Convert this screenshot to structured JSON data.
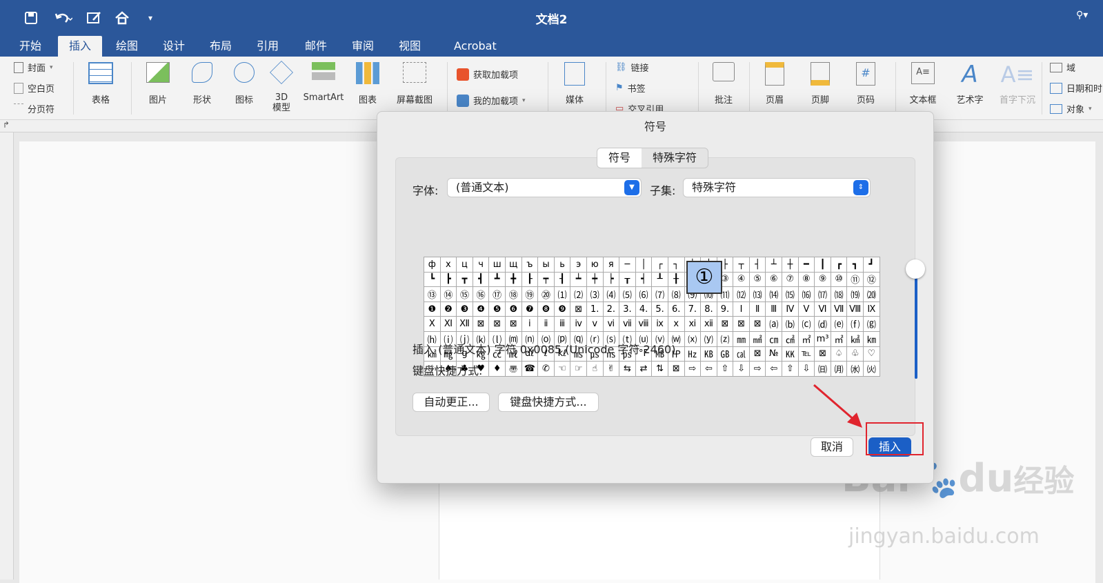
{
  "window": {
    "title": "文档2"
  },
  "ribbon_tabs": [
    "开始",
    "插入",
    "绘图",
    "设计",
    "布局",
    "引用",
    "邮件",
    "审阅",
    "视图",
    "Acrobat"
  ],
  "ribbon": {
    "pages": [
      "封面",
      "空白页",
      "分页符"
    ],
    "table": "表格",
    "picture": "图片",
    "shapes": "形状",
    "icons": "图标",
    "model3d": "3D\n模型",
    "smartart": "SmartArt",
    "chart": "图表",
    "screenshot": "屏幕截图",
    "addins": [
      "获取加载项",
      "我的加载项"
    ],
    "media": "媒体",
    "links": [
      "链接",
      "书签",
      "交叉引用"
    ],
    "comment": "批注",
    "header": "页眉",
    "footer": "页脚",
    "pagenum": "页码",
    "textbox": "文本框",
    "wordart": "艺术字",
    "dropcap": "首字下沉",
    "right": [
      "域",
      "日期和时",
      "对象"
    ]
  },
  "dialog": {
    "title": "符号",
    "tabs": [
      "符号",
      "特殊字符"
    ],
    "font_label": "字体:",
    "font_value": "(普通文本)",
    "subset_label": "子集:",
    "subset_value": "特殊字符",
    "grid": [
      [
        "ф",
        "х",
        "ц",
        "ч",
        "ш",
        "щ",
        "ъ",
        "ы",
        "ь",
        "э",
        "ю",
        "я",
        "─",
        "│",
        "┌",
        "┐",
        "└",
        "┘",
        "├",
        "┬",
        "┤",
        "┴",
        "┼",
        "━",
        "┃",
        "┏",
        "┓",
        "┛"
      ],
      [
        "┗",
        "┣",
        "┳",
        "┫",
        "┻",
        "╋",
        "┠",
        "┯",
        "┨",
        "┷",
        "┿",
        "┝",
        "┰",
        "┥",
        "┸",
        "╂",
        "①",
        "②",
        "③",
        "④",
        "⑤",
        "⑥",
        "⑦",
        "⑧",
        "⑨",
        "⑩",
        "⑪",
        "⑫"
      ],
      [
        "⑬",
        "⑭",
        "⑮",
        "⑯",
        "⑰",
        "⑱",
        "⑲",
        "⑳",
        "⑴",
        "⑵",
        "⑶",
        "⑷",
        "⑸",
        "⑹",
        "⑺",
        "⑻",
        "⑼",
        "⑽",
        "⑾",
        "⑿",
        "⒀",
        "⒁",
        "⒂",
        "⒃",
        "⒄",
        "⒅",
        "⒆",
        "⒇"
      ],
      [
        "❶",
        "❷",
        "❸",
        "❹",
        "❺",
        "❻",
        "❼",
        "❽",
        "❾",
        "⊠",
        "1.",
        "2.",
        "3.",
        "4.",
        "5.",
        "6.",
        "7.",
        "8.",
        "9.",
        "Ⅰ",
        "Ⅱ",
        "Ⅲ",
        "Ⅳ",
        "Ⅴ",
        "Ⅵ",
        "Ⅶ",
        "Ⅷ",
        "Ⅸ"
      ],
      [
        "Ⅹ",
        "Ⅺ",
        "Ⅻ",
        "⊠",
        "⊠",
        "⊠",
        "ⅰ",
        "ⅱ",
        "ⅲ",
        "ⅳ",
        "ⅴ",
        "ⅵ",
        "ⅶ",
        "ⅷ",
        "ⅸ",
        "ⅹ",
        "ⅺ",
        "ⅻ",
        "⊠",
        "⊠",
        "⊠",
        "⒜",
        "⒝",
        "⒞",
        "⒟",
        "⒠",
        "⒡",
        "⒢"
      ],
      [
        "⒣",
        "⒤",
        "⒥",
        "⒦",
        "⒧",
        "⒨",
        "⒩",
        "⒪",
        "⒫",
        "⒬",
        "⒭",
        "⒮",
        "⒯",
        "⒰",
        "⒱",
        "⒲",
        "⒳",
        "⒴",
        "⒵",
        "㎜",
        "㎟",
        "㎝",
        "㎠",
        "㎡",
        "m³",
        "㎡",
        "㎢",
        "㎞"
      ],
      [
        "㎢",
        "㎎",
        "g",
        "㎏",
        "㏄",
        "㎖",
        "dℓ",
        "ℓ",
        "kℓ",
        "㎳",
        "㎲",
        "㎱",
        "㎰",
        "°F",
        "㎆",
        "㏋",
        "㎐",
        "㎅",
        "㎇",
        "㎈",
        "⊠",
        "№",
        "㏍",
        "℡",
        "⊠",
        "♤",
        "♧",
        "♡"
      ],
      [
        "♢",
        "♠",
        "♣",
        "♥",
        "♦",
        "〠",
        "☎",
        "✆",
        "☜",
        "☞",
        "☝",
        "✌",
        "⇆",
        "⇄",
        "⇅",
        "⊠",
        "⇨",
        "⇦",
        "⇧",
        "⇩",
        "⇨",
        "⇦",
        "⇧",
        "⇩",
        "㈰",
        "㈪",
        "㈬",
        "㈫"
      ]
    ],
    "zoom_char": "①",
    "insert_info": "插入 (普通文本) 字符 0x0085 (Unicode 字符 2460)",
    "shortcut_label": "键盘快捷方式:",
    "autocorrect_btn": "自动更正...",
    "shortcut_btn": "键盘快捷方式...",
    "cancel_btn": "取消",
    "insert_btn": "插入"
  },
  "watermark": {
    "brand": "Bai",
    "brand2": "du",
    "cn": "经验",
    "url": "jingyan.baidu.com"
  },
  "colors": {
    "titlebar": "#2b579a",
    "accent": "#1b5fc6",
    "highlight": "#e0242e"
  }
}
